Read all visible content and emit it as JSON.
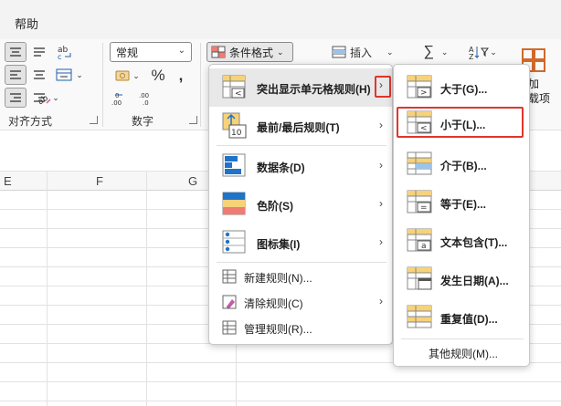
{
  "tabs": {
    "help": "帮助"
  },
  "ribbon": {
    "number_format": "常规",
    "conditional_format": "条件格式",
    "insert": "插入",
    "groups": {
      "alignment": "对齐方式",
      "number": "数字"
    },
    "right_partial": {
      "line1": "加",
      "line2": "载项"
    }
  },
  "grid": {
    "columns": [
      "E",
      "F",
      "G"
    ]
  },
  "cf_menu": {
    "items": [
      {
        "label": "突出显示单元格规则(H)",
        "has_sub": true
      },
      {
        "label": "最前/最后规则(T)",
        "has_sub": true
      },
      {
        "label": "数据条(D)",
        "has_sub": true
      },
      {
        "label": "色阶(S)",
        "has_sub": true
      },
      {
        "label": "图标集(I)",
        "has_sub": true
      },
      {
        "label": "新建规则(N)...",
        "has_sub": false
      },
      {
        "label": "清除规则(C)",
        "has_sub": true
      },
      {
        "label": "管理规则(R)...",
        "has_sub": false
      }
    ]
  },
  "sub_menu": {
    "items": [
      {
        "label": "大于(G)..."
      },
      {
        "label": "小于(L)..."
      },
      {
        "label": "介于(B)..."
      },
      {
        "label": "等于(E)..."
      },
      {
        "label": "文本包含(T)..."
      },
      {
        "label": "发生日期(A)..."
      },
      {
        "label": "重复值(D)..."
      }
    ],
    "other": "其他规则(M)..."
  },
  "colors": {
    "highlight_border": "#e0352b",
    "bar_blue": "#1f73c9",
    "yellow": "#f6d27a",
    "red": "#f07b73"
  }
}
